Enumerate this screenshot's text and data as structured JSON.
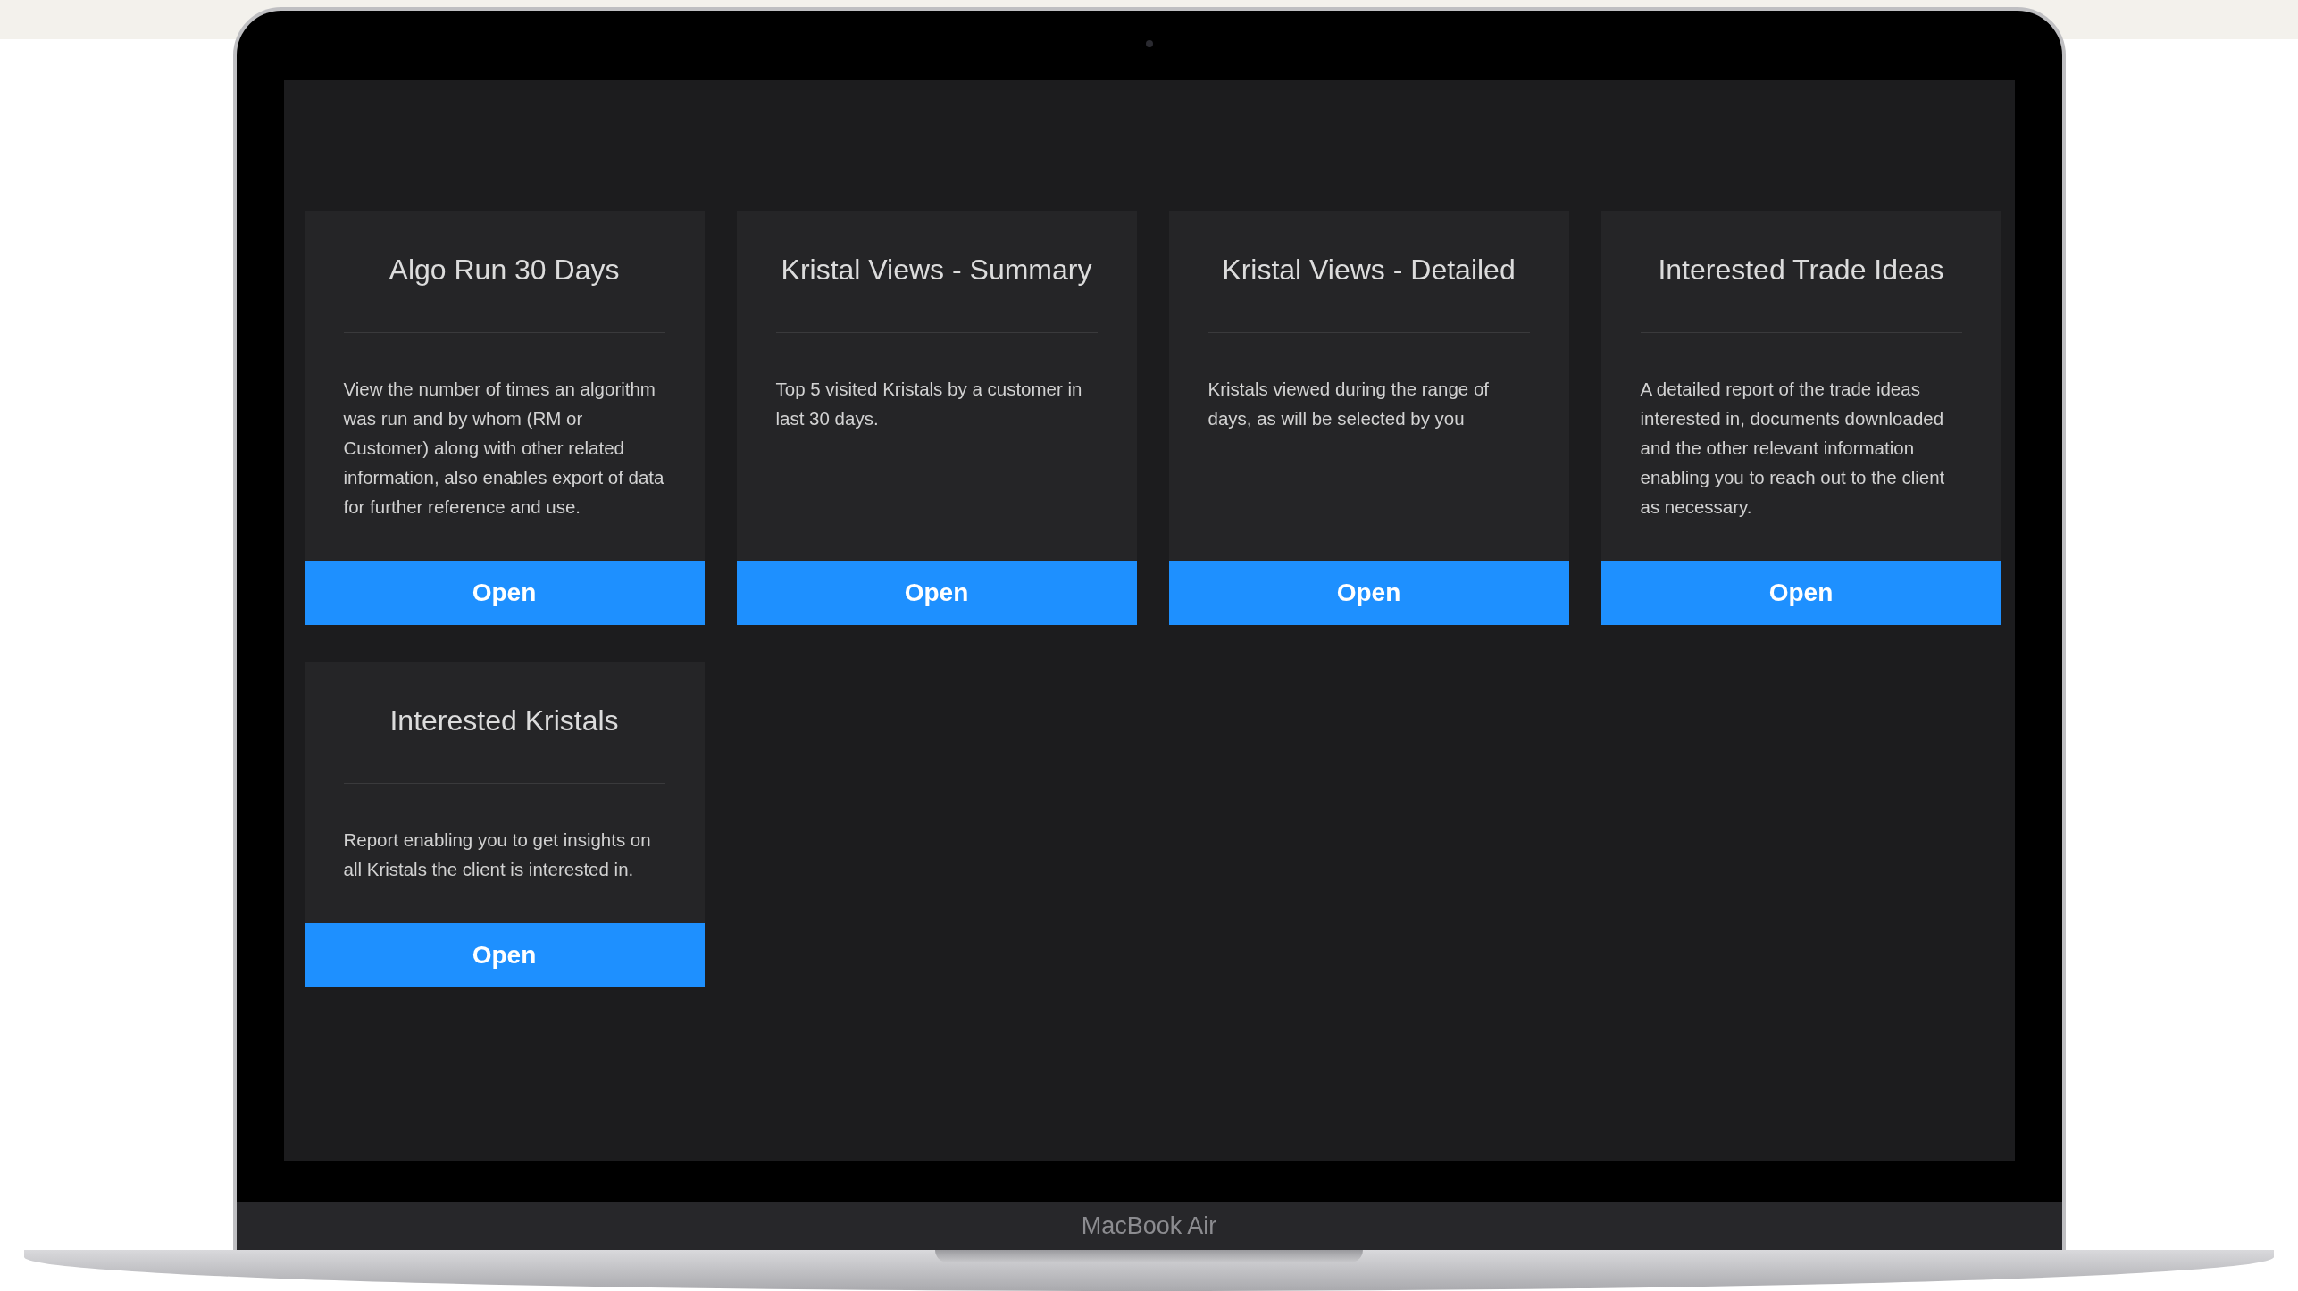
{
  "cards": [
    {
      "title": "Algo Run 30 Days",
      "description": "View the number of times an algorithm was run and by whom (RM or Customer) along with other related information, also enables export of data for further reference and use.",
      "button": "Open"
    },
    {
      "title": "Kristal Views - Summary",
      "description": "Top 5 visited Kristals by a customer in last 30 days.",
      "button": "Open"
    },
    {
      "title": "Kristal Views - Detailed",
      "description": "Kristals viewed during the range of days, as will be selected by you",
      "button": "Open"
    },
    {
      "title": "Interested Trade Ideas",
      "description": "A detailed report of the trade ideas interested in, documents downloaded and the other relevant information enabling you to reach out to the client as necessary.",
      "button": "Open"
    },
    {
      "title": "Interested Kristals",
      "description": "Report enabling you to get insights on all Kristals the client is interested in.",
      "button": "Open"
    }
  ],
  "device_label": "MacBook Air"
}
